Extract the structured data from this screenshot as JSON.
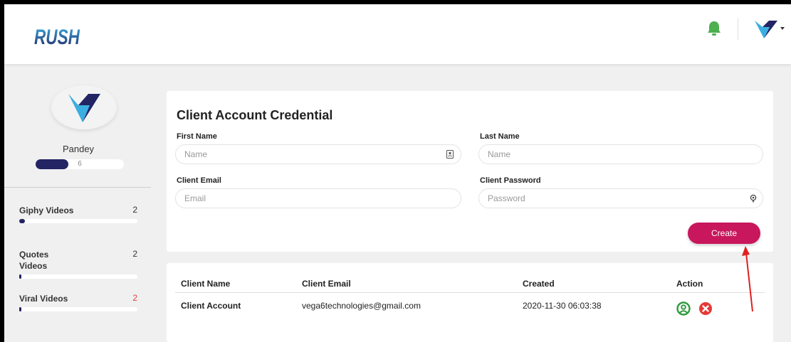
{
  "header": {
    "logo_text": "RUSH"
  },
  "sidebar": {
    "username": "Pandey",
    "level_value": "6",
    "stats": [
      {
        "label": "Giphy Videos",
        "count": "2",
        "progress": 0.05
      },
      {
        "label": "Quotes Videos",
        "count": "2",
        "progress": 0.01
      },
      {
        "label": "Viral Videos",
        "count": "2",
        "progress": 0.01
      }
    ]
  },
  "form": {
    "title": "Client Account Credential",
    "first_name_label": "First Name",
    "first_name_placeholder": "Name",
    "last_name_label": "Last Name",
    "last_name_placeholder": "Name",
    "email_label": "Client Email",
    "email_placeholder": "Email",
    "password_label": "Client Password",
    "password_placeholder": "Password",
    "create_label": "Create"
  },
  "table": {
    "headers": [
      "Client Name",
      "Client Email",
      "Created",
      "Action"
    ],
    "rows": [
      {
        "name": "Client Account",
        "email": "vega6technologies@gmail.com",
        "created": "2020-11-30 06:03:38"
      }
    ]
  },
  "colors": {
    "brand_dark": "#232464",
    "brand_light": "#3aaee0",
    "create_button": "#c8175d",
    "bell": "#4caf50",
    "user_action": "#2e9a3c",
    "delete_action": "#e53935",
    "annotation_arrow": "#e02020"
  },
  "icons": {
    "notifications": "bell-icon",
    "profile_avatar": "v-logo-icon",
    "first_name_field": "contact-card-icon",
    "password_field": "key-icon",
    "view_user": "user-circle-icon",
    "delete_user": "close-circle-icon"
  }
}
